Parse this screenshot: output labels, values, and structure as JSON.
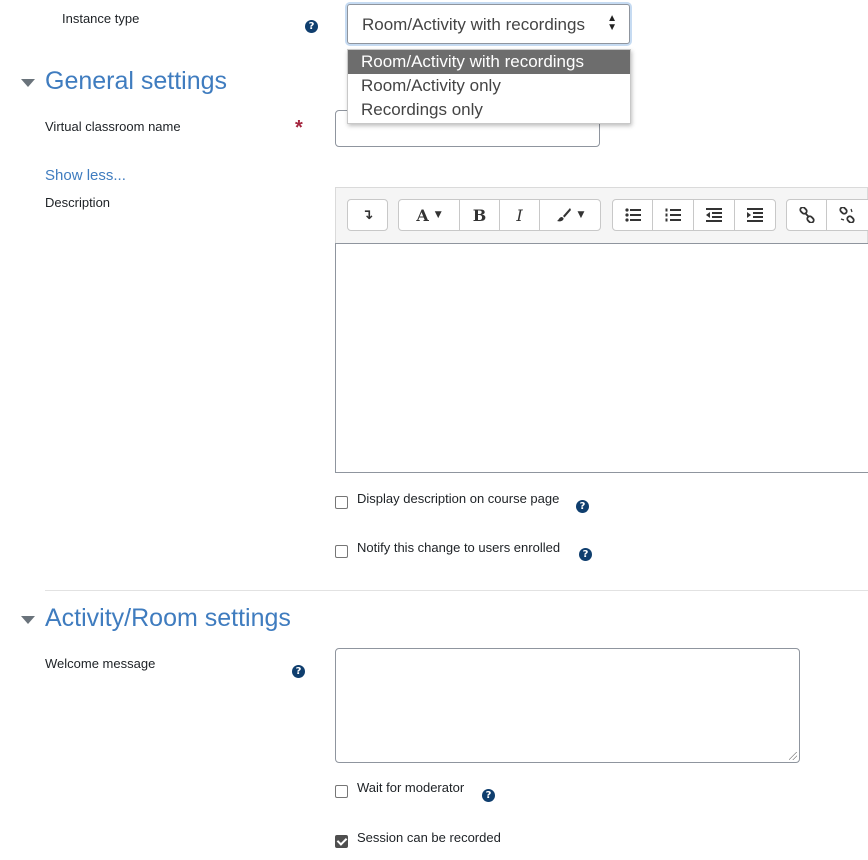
{
  "instance_type": {
    "label": "Instance type",
    "selected": "Room/Activity with recordings",
    "options": [
      "Room/Activity with recordings",
      "Room/Activity only",
      "Recordings only"
    ],
    "help_icon": "question-circle-icon"
  },
  "general_settings": {
    "title": "General settings",
    "name_label": "Virtual classroom name",
    "name_value": "",
    "required_icon": "asterisk-icon",
    "show_less": "Show less...",
    "description_label": "Description",
    "toolbar": {
      "collapse": "↴",
      "font": "A",
      "bold": "B",
      "italic": "I",
      "icons": [
        "toolbar-toggle-icon",
        "font-style-icon",
        "bold-icon",
        "italic-icon",
        "brush-icon",
        "unordered-list-icon",
        "ordered-list-icon",
        "outdent-icon",
        "indent-icon",
        "link-icon",
        "unlink-icon"
      ]
    },
    "display_description_label": "Display description on course page",
    "display_description_checked": false,
    "notify_label": "Notify this change to users enrolled",
    "notify_checked": false
  },
  "activity_room_settings": {
    "title": "Activity/Room settings",
    "welcome_label": "Welcome message",
    "welcome_value": "",
    "wait_label": "Wait for moderator",
    "wait_checked": false,
    "record_label": "Session can be recorded",
    "record_checked": true
  },
  "colors": {
    "accent": "#3f7cbf",
    "required": "#a4253e",
    "help": "#0f3e6e"
  }
}
